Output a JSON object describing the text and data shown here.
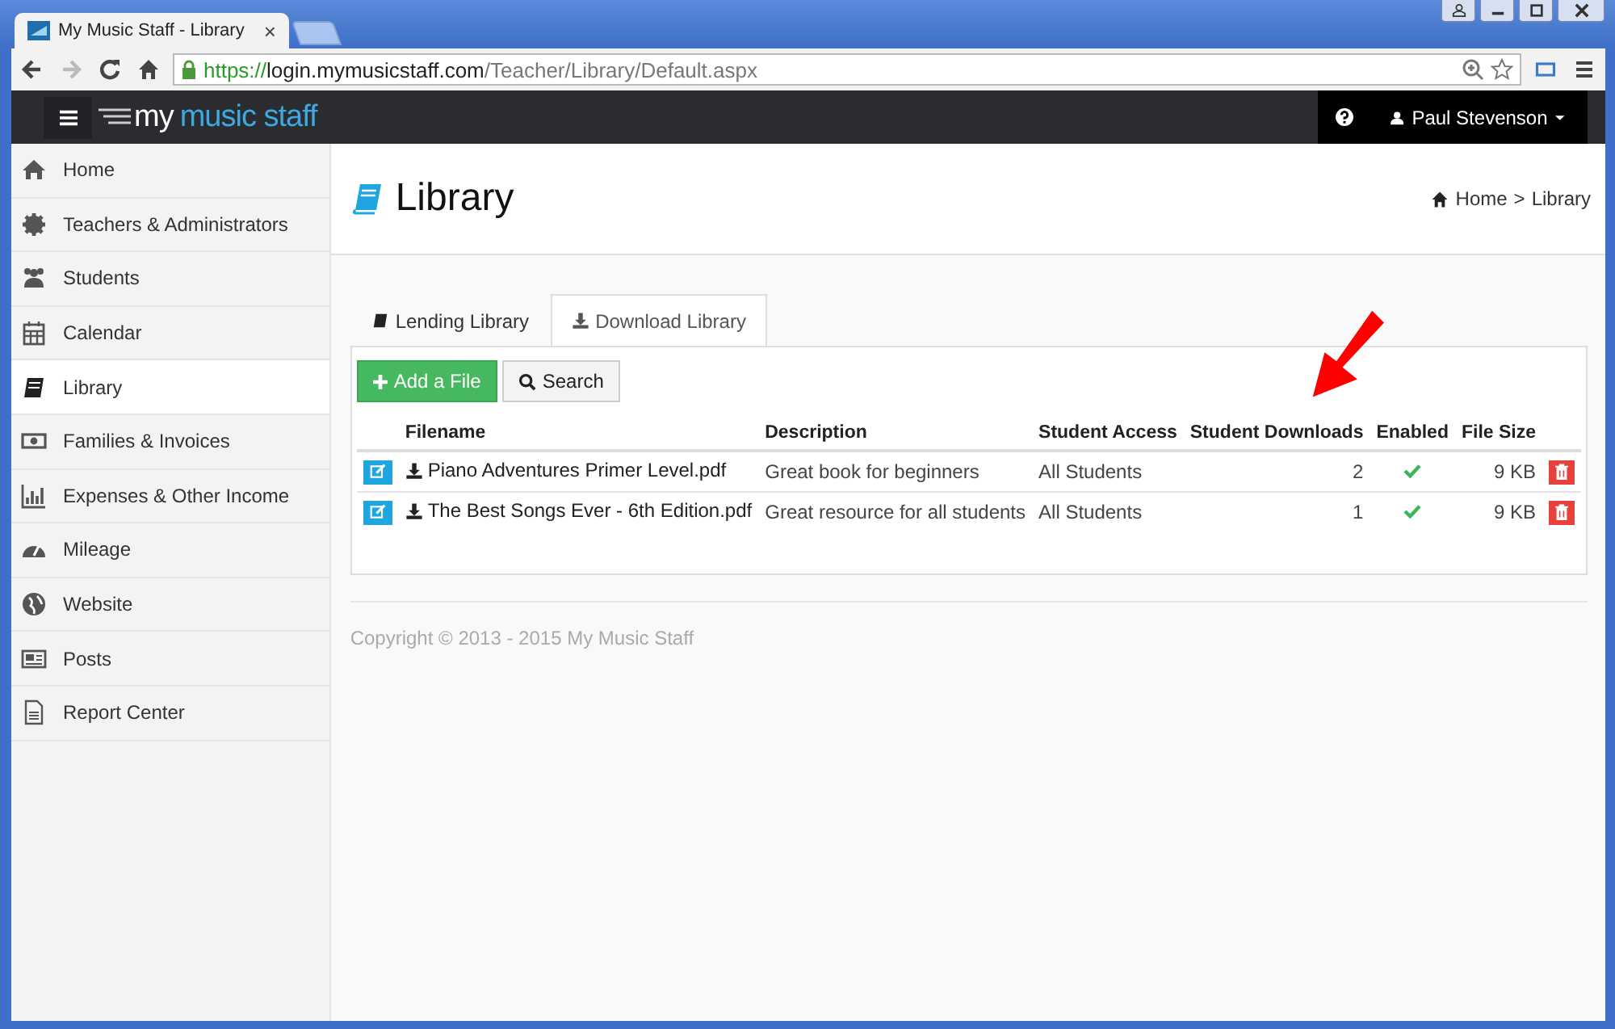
{
  "browser": {
    "tab_title": "My Music Staff - Library",
    "tab_close": "×",
    "url_scheme": "https://",
    "url_host": "login.mymusicstaff.com",
    "url_path": "/Teacher/Library/Default.aspx"
  },
  "navbar": {
    "logo_my": "my",
    "logo_rest": "music staff",
    "user": "Paul Stevenson"
  },
  "sidebar": {
    "items": [
      {
        "label": "Home",
        "selected": false
      },
      {
        "label": "Teachers & Administrators",
        "selected": false
      },
      {
        "label": "Students",
        "selected": false
      },
      {
        "label": "Calendar",
        "selected": false
      },
      {
        "label": "Library",
        "selected": true
      },
      {
        "label": "Families & Invoices",
        "selected": false
      },
      {
        "label": "Expenses & Other Income",
        "selected": false
      },
      {
        "label": "Mileage",
        "selected": false
      },
      {
        "label": "Website",
        "selected": false
      },
      {
        "label": "Posts",
        "selected": false
      },
      {
        "label": "Report Center",
        "selected": false
      }
    ]
  },
  "page": {
    "title": "Library",
    "breadcrumb": [
      {
        "label": "Home"
      },
      {
        "label": "Library"
      }
    ],
    "breadcrumb_separator": ">"
  },
  "tabs": [
    {
      "label": "Lending Library",
      "selected": false
    },
    {
      "label": "Download Library",
      "selected": true
    }
  ],
  "buttons": {
    "add": "Add a File",
    "search": "Search"
  },
  "table": {
    "columns": [
      "Filename",
      "Description",
      "Student Access",
      "Student Downloads",
      "Enabled",
      "File Size"
    ],
    "rows": [
      {
        "filename": "Piano Adventures Primer Level.pdf",
        "description": "Great book for beginners",
        "access": "All Students",
        "downloads": "2",
        "enabled": true,
        "size": "9 KB"
      },
      {
        "filename": "The Best Songs Ever - 6th Edition.pdf",
        "description": "Great resource for all students",
        "access": "All Students",
        "downloads": "1",
        "enabled": true,
        "size": "9 KB"
      }
    ]
  },
  "footer": "Copyright © 2013 - 2015 My Music Staff"
}
